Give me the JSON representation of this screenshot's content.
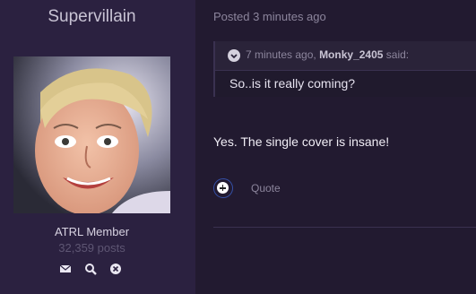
{
  "author": {
    "username": "Supervillain",
    "title": "ATRL Member",
    "post_count": "32,359 posts",
    "icons": [
      "envelope-icon",
      "search-icon",
      "close-icon"
    ]
  },
  "post": {
    "posted_time": "Posted 3 minutes ago",
    "quote": {
      "time": "7 minutes ago,",
      "author": "Monky_2405",
      "said": "said:",
      "text": "So..is it really coming?"
    },
    "body": "Yes. The single cover is insane!",
    "actions": {
      "quote_label": "Quote"
    }
  },
  "colors": {
    "background": "#221a30",
    "sidebar": "#2b2140",
    "accent_ring": "#3550a8"
  }
}
